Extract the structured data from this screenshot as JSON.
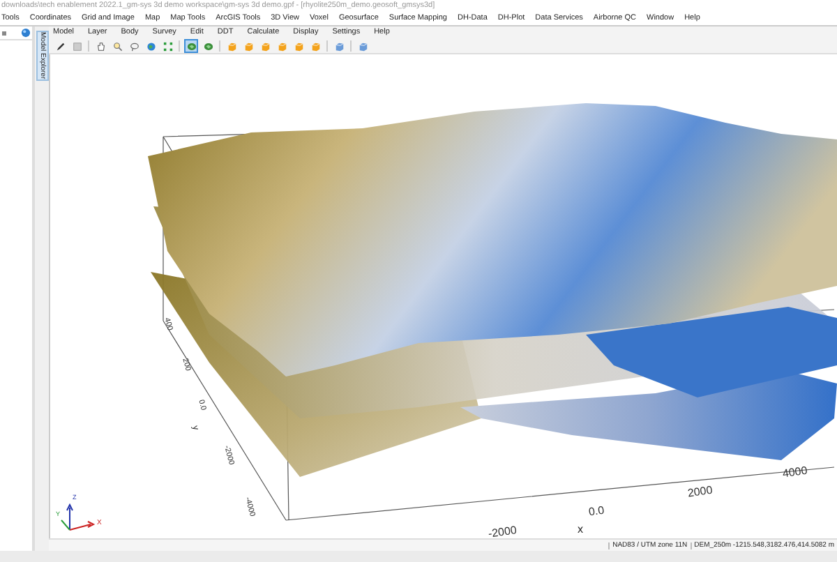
{
  "window": {
    "title": "downloads\\tech enablement 2022.1_gm-sys 3d demo workspace\\gm-sys 3d demo.gpf - [rhyolite250m_demo.geosoft_gmsys3d]"
  },
  "main_menu": [
    "Tools",
    "Coordinates",
    "Grid and Image",
    "Map",
    "Map Tools",
    "ArcGIS Tools",
    "3D View",
    "Voxel",
    "Geosurface",
    "Surface Mapping",
    "DH-Data",
    "DH-Plot",
    "Data Services",
    "Airborne QC",
    "Window",
    "Help"
  ],
  "side_tab": {
    "label": "Model Explorer",
    "selected": true
  },
  "model_menu": [
    "Model",
    "Layer",
    "Body",
    "Survey",
    "Edit",
    "DDT",
    "Calculate",
    "Display",
    "Settings",
    "Help"
  ],
  "toolbar_groups": [
    [
      {
        "kind": "pencil",
        "selected": false
      },
      {
        "kind": "grid",
        "selected": false
      }
    ],
    [
      {
        "kind": "hand",
        "selected": false
      },
      {
        "kind": "zoom",
        "selected": false
      },
      {
        "kind": "lasso",
        "selected": false
      },
      {
        "kind": "globe",
        "selected": false
      },
      {
        "kind": "fit",
        "selected": false
      }
    ],
    [
      {
        "kind": "map",
        "selected": true
      },
      {
        "kind": "map",
        "selected": false
      }
    ],
    [
      {
        "kind": "cube",
        "selected": false
      },
      {
        "kind": "cube",
        "selected": false
      },
      {
        "kind": "cube",
        "selected": false
      },
      {
        "kind": "cube",
        "selected": false
      },
      {
        "kind": "cube",
        "selected": false
      },
      {
        "kind": "cube",
        "selected": false
      }
    ],
    [
      {
        "kind": "cube-blue",
        "selected": false
      }
    ],
    [
      {
        "kind": "cube-blue",
        "selected": false
      }
    ]
  ],
  "view": {
    "y_axis": {
      "title": "y",
      "ticks": [
        "400",
        "200",
        "0.0",
        "-2000",
        "-4000"
      ]
    },
    "x_axis": {
      "title": "x",
      "ticks": [
        "-2000",
        "0.0",
        "2000",
        "4000"
      ]
    },
    "triad": [
      "Z",
      "Y",
      "X"
    ]
  },
  "status_bar": [
    "NAD83 / UTM zone 11N",
    "DEM_250m -1215.548,3182.476,414.5082 m"
  ]
}
